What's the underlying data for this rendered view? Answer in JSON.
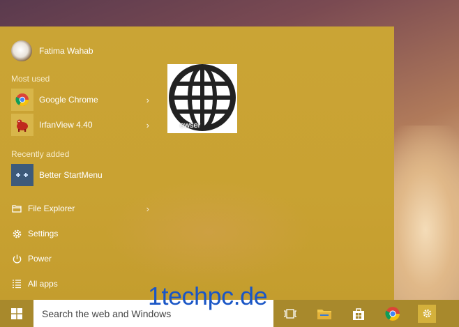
{
  "user": {
    "name": "Fatima Wahab"
  },
  "sections": {
    "most_used": "Most used",
    "recently_added": "Recently added"
  },
  "apps": {
    "chrome": "Google Chrome",
    "irfanview": "IrfanView 4.40",
    "better_start": "Better StartMenu"
  },
  "system": {
    "file_explorer": "File Explorer",
    "settings": "Settings",
    "power": "Power",
    "all_apps": "All apps"
  },
  "tile": {
    "label": "owser"
  },
  "taskbar": {
    "search_placeholder": "Search the web and Windows"
  },
  "watermark": "1techpc.de",
  "icons": [
    "windows-icon",
    "task-view-icon",
    "file-explorer-icon",
    "store-icon",
    "chrome-icon",
    "settings-icon",
    "power-icon",
    "all-apps-icon",
    "globe-icon"
  ],
  "colors": {
    "menu_accent": "#c9a232",
    "taskbar": "#a8892c",
    "watermark": "#1a56c6"
  }
}
